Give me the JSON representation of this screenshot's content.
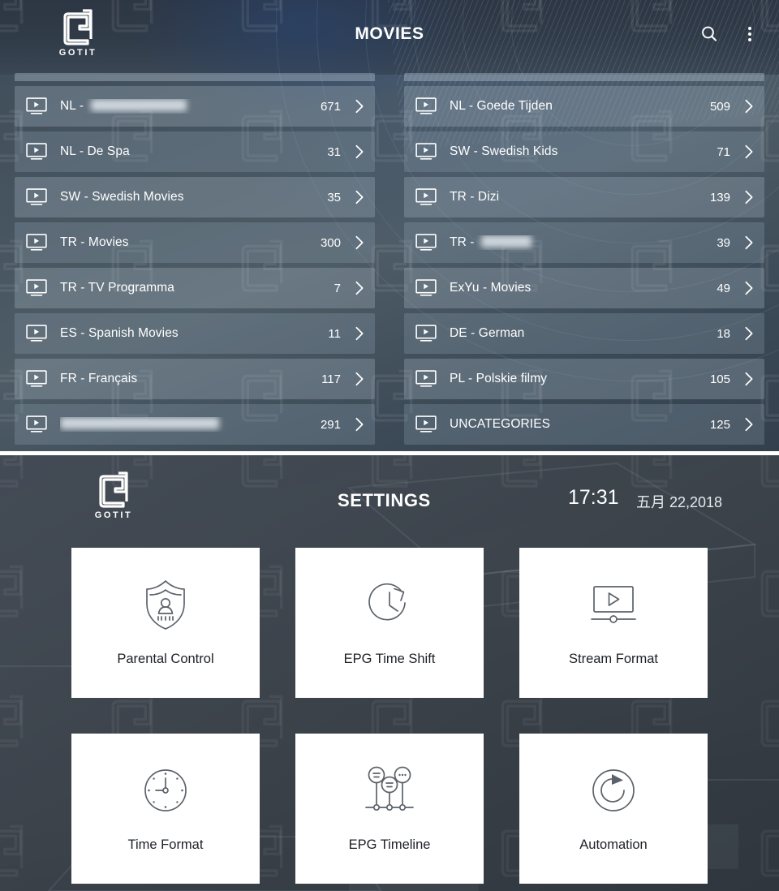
{
  "brand": {
    "name": "GOTIT",
    "logo_icon": "gotit-logo-icon"
  },
  "movies": {
    "title": "MOVIES",
    "search_icon": "search-icon",
    "overflow_icon": "more-vertical-icon",
    "row_icon": "tv-play-icon",
    "chevron_icon": "chevron-right-icon",
    "left_column": [
      {
        "label": "NL - ",
        "redacted": true,
        "redact_width": 118,
        "count": "671"
      },
      {
        "label": "NL - De Spa",
        "redacted": false,
        "count": "31"
      },
      {
        "label": "SW - Swedish Movies",
        "redacted": false,
        "count": "35"
      },
      {
        "label": "TR - Movies",
        "redacted": false,
        "count": "300"
      },
      {
        "label": "TR - TV Programma",
        "redacted": false,
        "count": "7"
      },
      {
        "label": "ES - Spanish Movies",
        "redacted": false,
        "count": "11"
      },
      {
        "label": "FR - Français",
        "redacted": false,
        "count": "117"
      },
      {
        "label": "",
        "redacted": true,
        "redact_width": 196,
        "count": "291"
      }
    ],
    "right_column": [
      {
        "label": "NL - Goede Tijden",
        "redacted": false,
        "count": "509"
      },
      {
        "label": "SW - Swedish Kids",
        "redacted": false,
        "count": "71"
      },
      {
        "label": "TR - Dizi",
        "redacted": false,
        "count": "139"
      },
      {
        "label": "TR - ",
        "redacted": true,
        "redact_width": 62,
        "count": "39"
      },
      {
        "label": "ExYu - Movies",
        "redacted": false,
        "count": "49"
      },
      {
        "label": "DE - German",
        "redacted": false,
        "count": "18"
      },
      {
        "label": "PL - Polskie filmy",
        "redacted": false,
        "count": "105"
      },
      {
        "label": "UNCATEGORIES",
        "redacted": false,
        "count": "125"
      }
    ]
  },
  "settings": {
    "title": "SETTINGS",
    "time": "17:31",
    "date": "五月 22,2018",
    "tiles": [
      {
        "label": "Parental Control",
        "icon": "shield-user-lock-icon"
      },
      {
        "label": "EPG Time Shift",
        "icon": "clock-forward-icon"
      },
      {
        "label": "Stream Format",
        "icon": "video-player-slider-icon"
      },
      {
        "label": "Time Format",
        "icon": "analog-clock-icon"
      },
      {
        "label": "EPG Timeline",
        "icon": "timeline-nodes-icon"
      },
      {
        "label": "Automation",
        "icon": "refresh-circle-icon"
      }
    ]
  },
  "colors": {
    "panel_bg": "#3e4b59",
    "row_bg": "#a8bbc8",
    "tile_bg": "#ffffff",
    "text_light": "#ffffff",
    "text_dark": "#1d2025",
    "divider": "#ffffff"
  }
}
